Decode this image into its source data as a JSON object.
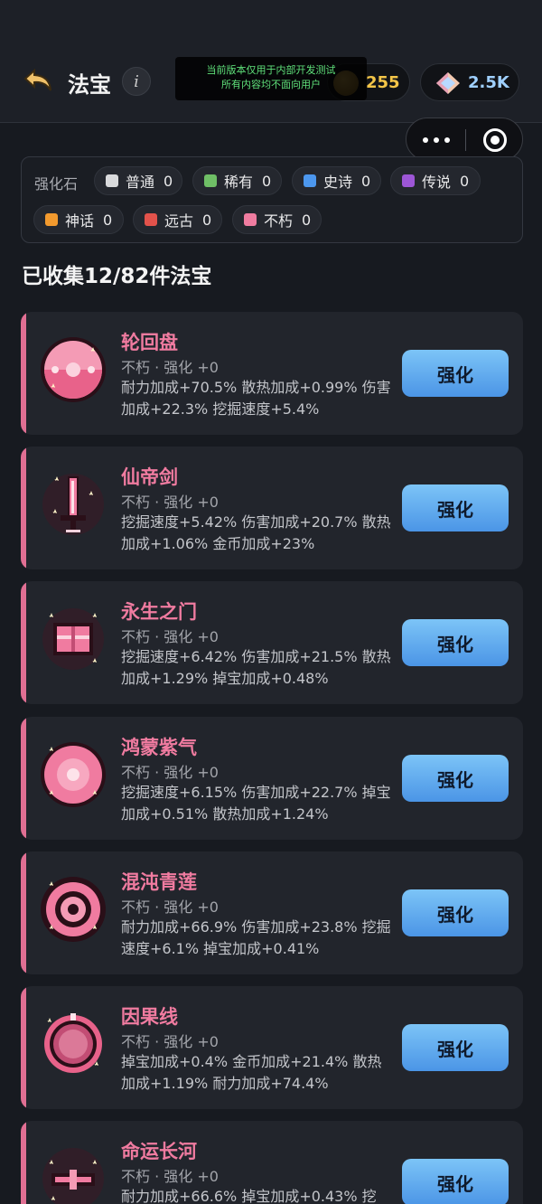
{
  "header": {
    "title": "法宝",
    "info_label": "i",
    "notice_line1": "当前版本仅用于内部开发测试",
    "notice_line2": "所有内容均不面向用户",
    "coins": "255",
    "gems": "2.5K"
  },
  "stones": {
    "label": "强化石",
    "items": [
      {
        "name": "普通",
        "count": "0",
        "color": "#d9dadc"
      },
      {
        "name": "稀有",
        "count": "0",
        "color": "#6fbf66"
      },
      {
        "name": "史诗",
        "count": "0",
        "color": "#4c97ee"
      },
      {
        "name": "传说",
        "count": "0",
        "color": "#9d56d6"
      },
      {
        "name": "神话",
        "count": "0",
        "color": "#f29a2e"
      },
      {
        "name": "远古",
        "count": "0",
        "color": "#e2524b"
      },
      {
        "name": "不朽",
        "count": "0",
        "color": "#ef7ca0"
      }
    ]
  },
  "collected": "已收集12/82件法宝",
  "items": [
    {
      "name": "轮回盘",
      "grade": "不朽 · 强化 +0",
      "desc": "耐力加成+70.5% 散热加成+0.99% 伤害加成+22.3% 挖掘速度+5.4%",
      "button": "强化",
      "icon": "reincarnation-disc-icon"
    },
    {
      "name": "仙帝剑",
      "grade": "不朽 · 强化 +0",
      "desc": "挖掘速度+5.42% 伤害加成+20.7% 散热加成+1.06% 金币加成+23%",
      "button": "强化",
      "icon": "sword-icon"
    },
    {
      "name": "永生之门",
      "grade": "不朽 · 强化 +0",
      "desc": "挖掘速度+6.42% 伤害加成+21.5% 散热加成+1.29% 掉宝加成+0.48%",
      "button": "强化",
      "icon": "gate-icon"
    },
    {
      "name": "鸿蒙紫气",
      "grade": "不朽 · 强化 +0",
      "desc": "挖掘速度+6.15% 伤害加成+22.7% 掉宝加成+0.51% 散热加成+1.24%",
      "button": "强化",
      "icon": "orb-icon"
    },
    {
      "name": "混沌青莲",
      "grade": "不朽 · 强化 +0",
      "desc": "耐力加成+66.9% 伤害加成+23.8% 挖掘速度+6.1% 掉宝加成+0.41%",
      "button": "强化",
      "icon": "ring-icon"
    },
    {
      "name": "因果线",
      "grade": "不朽 · 强化 +0",
      "desc": "掉宝加成+0.4% 金币加成+21.4% 散热加成+1.19% 耐力加成+74.4%",
      "button": "强化",
      "icon": "thread-icon"
    },
    {
      "name": "命运长河",
      "grade": "不朽 · 强化 +0",
      "desc": "耐力加成+66.6% 掉宝加成+0.43% 挖",
      "button": "强化",
      "icon": "river-icon"
    }
  ]
}
